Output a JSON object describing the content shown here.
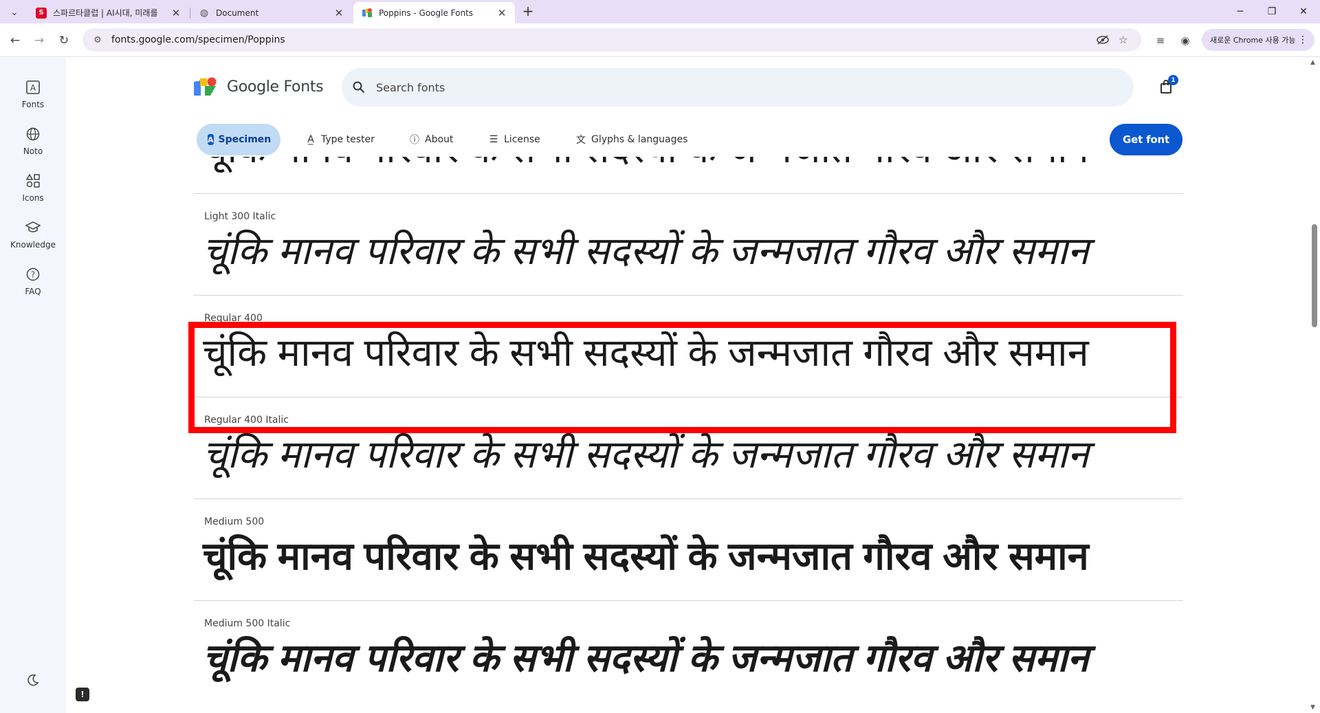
{
  "browser": {
    "tabs": [
      {
        "title": "스파르타클럽 | AI시대, 미래를",
        "favicon": "S"
      },
      {
        "title": "Document",
        "favicon": "globe-icon"
      },
      {
        "title": "Poppins - Google Fonts",
        "favicon": "google-fonts-icon"
      }
    ],
    "address": "fonts.google.com/specimen/Poppins",
    "chrome_pill": "새로운 Chrome 사용 가능"
  },
  "site": {
    "logo_text": "Google Fonts",
    "search_placeholder": "Search fonts",
    "cart_count": "1",
    "nav": [
      {
        "label": "Fonts",
        "icon": "font-icon"
      },
      {
        "label": "Noto",
        "icon": "globe-icon"
      },
      {
        "label": "Icons",
        "icon": "shapes-icon"
      },
      {
        "label": "Knowledge",
        "icon": "graduation-cap-icon"
      },
      {
        "label": "FAQ",
        "icon": "help-icon"
      }
    ],
    "page_tabs": [
      {
        "label": "Specimen",
        "icon": "specimen-icon",
        "active": true
      },
      {
        "label": "Type tester",
        "icon": "type-tester-icon"
      },
      {
        "label": "About",
        "icon": "info-icon"
      },
      {
        "label": "License",
        "icon": "license-icon"
      },
      {
        "label": "Glyphs & languages",
        "icon": "glyphs-icon"
      }
    ],
    "get_font": "Get font"
  },
  "specimen": {
    "sample_text": "चूंकि मानव परिवार के सभी सदस्यों के जन्मजात गौरव और समान",
    "styles": [
      {
        "label": ""
      },
      {
        "label": "Light 300 Italic"
      },
      {
        "label": "Regular 400"
      },
      {
        "label": "Regular 400 Italic"
      },
      {
        "label": "Medium 500"
      },
      {
        "label": "Medium 500 Italic"
      }
    ],
    "highlighted_style": "Regular 400"
  },
  "colors": {
    "primary": "#0b57d0",
    "highlight": "#ff0000",
    "tab_active_bg": "#c2dbf5"
  }
}
